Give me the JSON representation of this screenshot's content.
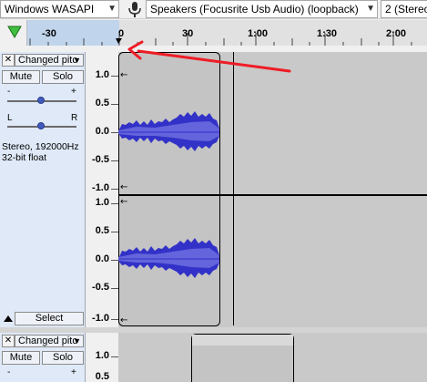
{
  "device_toolbar": {
    "host": "Windows WASAPI",
    "mic_icon": "microphone-icon",
    "recording_device": "Speakers (Focusrite Usb Audio) (loopback)",
    "channels": "2 (Stereo"
  },
  "timeline": {
    "play_icon": "green-triangle-icon",
    "labels": [
      "-30",
      "0",
      "30",
      "1:00",
      "1:30",
      "2:00"
    ]
  },
  "track1": {
    "name": "Changed pitc",
    "mute": "Mute",
    "solo": "Solo",
    "gain_minus": "-",
    "gain_plus": "+",
    "pan_left": "L",
    "pan_right": "R",
    "info_line1": "Stereo, 192000Hz",
    "info_line2": "32-bit float",
    "select": "Select",
    "scale": [
      "1.0",
      "0.5",
      "0.0",
      "-0.5",
      "-1.0"
    ]
  },
  "track2": {
    "name": "Changed pitc",
    "mute": "Mute",
    "solo": "Solo",
    "scale": [
      "1.0",
      "0.5"
    ]
  },
  "annotation_color": "#ee1c25",
  "waveform_color": "#3232c8"
}
